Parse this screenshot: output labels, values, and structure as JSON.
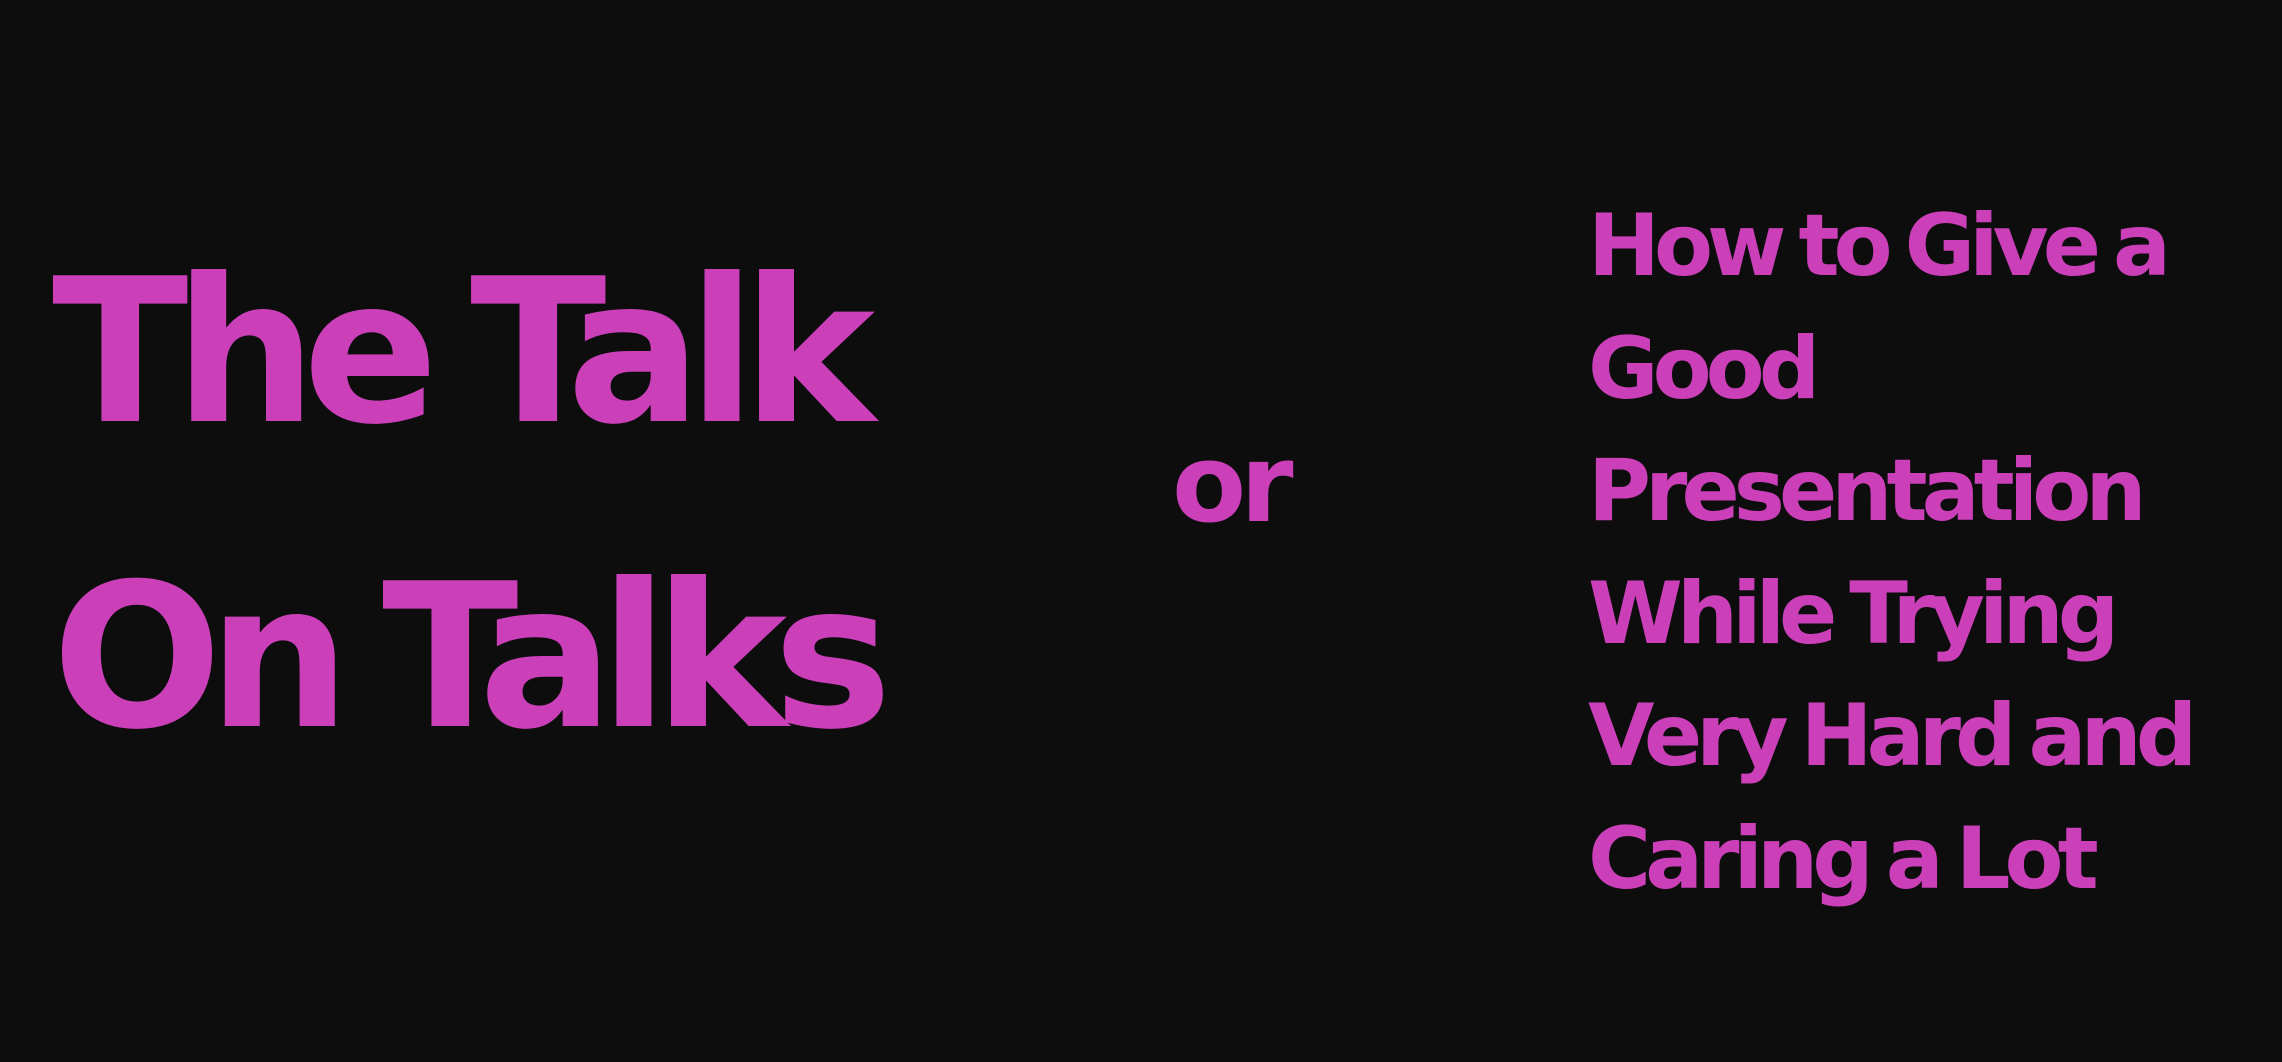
{
  "slide": {
    "title_lines": [
      "The Talk",
      "On Talks"
    ],
    "connector": "or",
    "subtitle_lines": [
      "How to Give a",
      "Good",
      "Presentation",
      "While Trying",
      "Very Hard and",
      "Caring a Lot"
    ]
  },
  "colors": {
    "background": "#0d0d0e",
    "text": "#cb3fb9"
  }
}
